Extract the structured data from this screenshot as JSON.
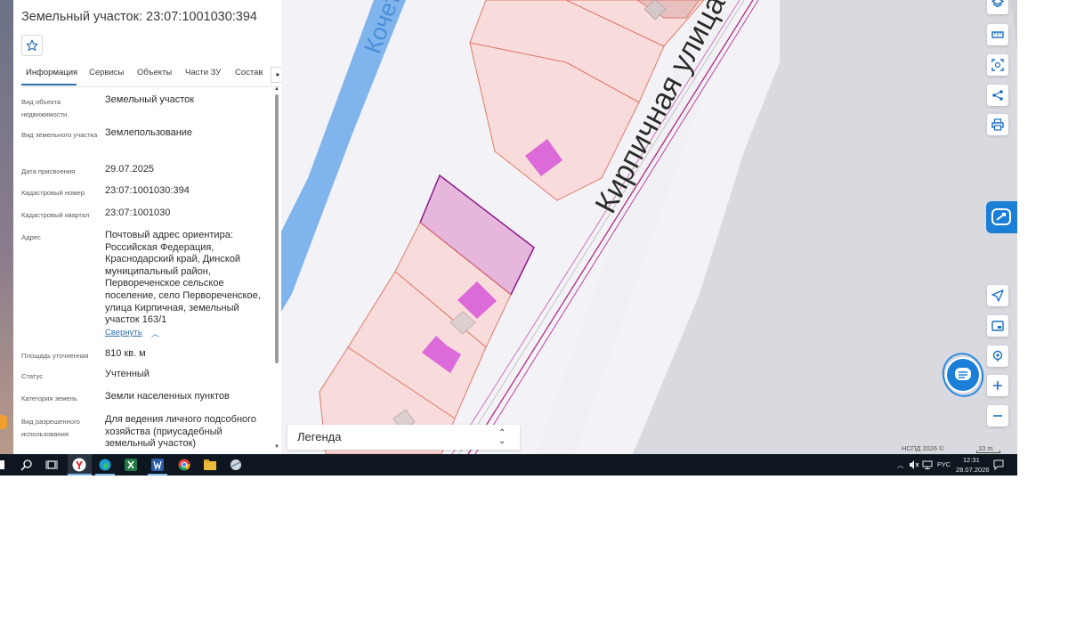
{
  "panel": {
    "title": "Земельный участок: 23:07:1001030:394",
    "tabs": [
      "Информация",
      "Сервисы",
      "Объекты",
      "Части ЗУ",
      "Состав"
    ],
    "rows": [
      {
        "label": "Вид объекта недвижимости",
        "value": "Земельный участок"
      },
      {
        "label": "Вид земельного участка",
        "value": "Землепользование"
      },
      {
        "label": "Дата присвоения",
        "value": "29.07.2025"
      },
      {
        "label": "Кадастровый номер",
        "value": "23:07:1001030:394"
      },
      {
        "label": "Кадастровый квартал",
        "value": "23:07:1001030"
      },
      {
        "label": "Адрес",
        "value": "Почтовый адрес ориентира: Российская Федерация, Краснодарский край, Динской муниципальный район, Первореченское сельское поселение, село Первореченское, улица Кирпичная, земельный участок 163/1"
      },
      {
        "label": "Площадь уточненная",
        "value": "810 кв. м"
      },
      {
        "label": "Статус",
        "value": "Учтенный"
      },
      {
        "label": "Категория земель",
        "value": "Земли населенных пунктов"
      },
      {
        "label": "Вид разрешенного использования",
        "value": "Для ведения личного подсобного хозяйства (приусадебный земельный участок)"
      }
    ],
    "collapse_label": "Свернуть"
  },
  "map": {
    "river_label": "Кочет",
    "street_label": "Кирпичная улица",
    "legend_label": "Легенда",
    "copyright": "НСПД 2026 ©",
    "scale": "10 m",
    "colors": {
      "parcel_fill": "#f8dcdc",
      "parcel_line": "#e07a6a",
      "selected_fill": "#e6b6dc",
      "selected_line": "#8a1a8a",
      "building": "#dc6ad8",
      "river": "#7fb4ec",
      "accent": "#1b7fd8"
    },
    "tools": [
      "layers-icon",
      "ruler-icon",
      "select-area-icon",
      "share-icon",
      "print-icon",
      "locate-icon",
      "minimap-icon",
      "geolocation-icon",
      "zoom-in-icon",
      "zoom-out-icon"
    ]
  },
  "taskbar": {
    "apps": [
      "search-icon",
      "task-view-icon",
      "yandex-browser-icon",
      "edge-icon",
      "excel-icon",
      "word-icon",
      "chrome-icon",
      "file-explorer-icon",
      "network-app-icon"
    ],
    "language": "РУС",
    "time": "12:31",
    "date": "28.07.2026"
  }
}
